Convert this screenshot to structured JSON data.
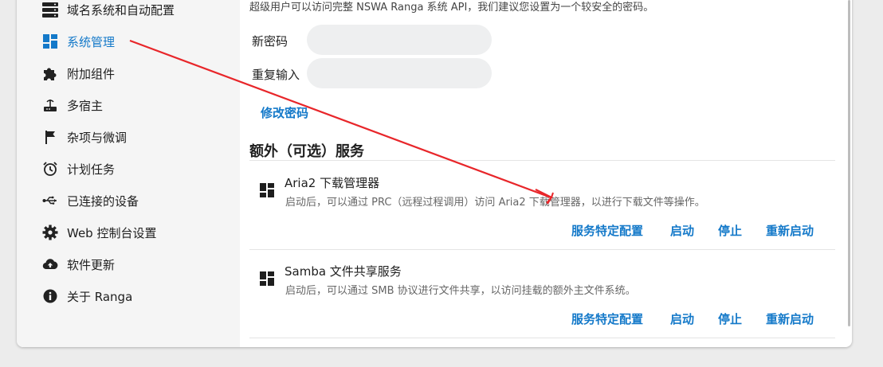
{
  "sidebar": {
    "items": [
      {
        "label": "域名系统和自动配置",
        "icon": "server-icon"
      },
      {
        "label": "系统管理",
        "icon": "dashboard-grid-icon",
        "active": true
      },
      {
        "label": "附加组件",
        "icon": "puzzle-icon"
      },
      {
        "label": "多宿主",
        "icon": "router-icon"
      },
      {
        "label": "杂项与微调",
        "icon": "flag-icon"
      },
      {
        "label": "计划任务",
        "icon": "alarm-clock-icon"
      },
      {
        "label": "已连接的设备",
        "icon": "usb-icon"
      },
      {
        "label": "Web 控制台设置",
        "icon": "gear-icon"
      },
      {
        "label": "软件更新",
        "icon": "cloud-upload-icon"
      },
      {
        "label": "关于 Ranga",
        "icon": "info-icon"
      }
    ]
  },
  "password": {
    "intro": "超级用户可以访问完整 NSWA Ranga 系统 API，我们建议您设置为一个较安全的密码。",
    "new_label": "新密码",
    "repeat_label": "重复输入",
    "change_link": "修改密码"
  },
  "services_section": {
    "title": "额外（可选）服务",
    "services": [
      {
        "name": "Aria2 下载管理器",
        "description": "启动后，可以通过 PRC（远程过程调用）访问 Aria2 下载管理器，以进行下载文件等操作。",
        "actions": [
          "服务特定配置",
          "启动",
          "停止",
          "重新启动"
        ]
      },
      {
        "name": "Samba 文件共享服务",
        "description": "启动后，可以通过 SMB 协议进行文件共享，以访问挂载的额外主文件系统。",
        "actions": [
          "服务特定配置",
          "启动",
          "停止",
          "重新启动"
        ]
      }
    ]
  },
  "colors": {
    "accent": "#1479c9",
    "annotation": "#e8262a"
  }
}
